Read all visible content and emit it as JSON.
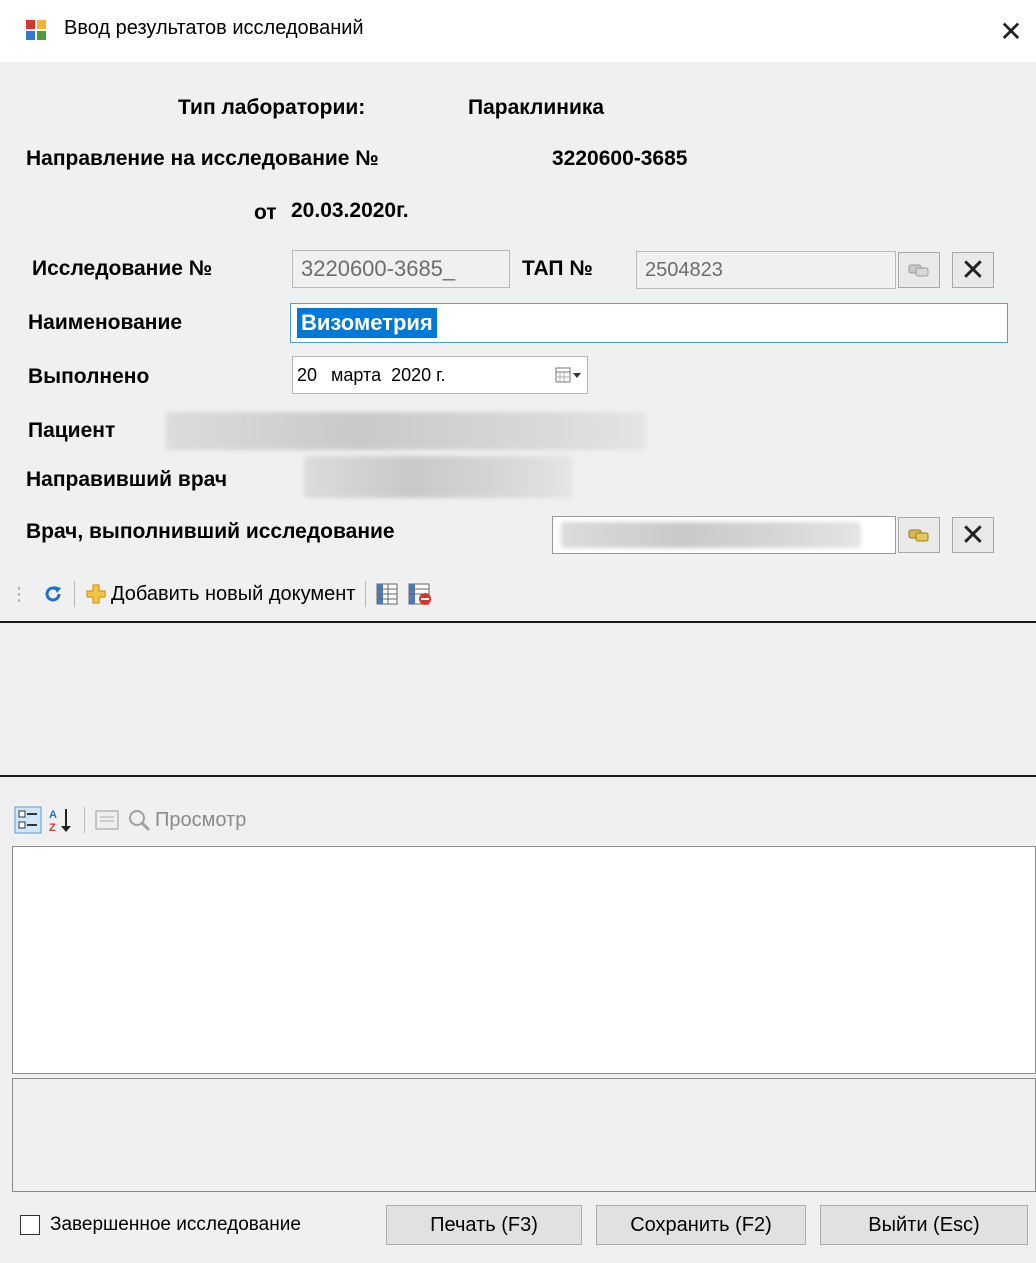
{
  "window": {
    "title": "Ввод результатов исследований",
    "close_glyph": "✕"
  },
  "header": {
    "lab_type_label": "Тип лаборатории:",
    "lab_type_value": "Параклиника",
    "referral_label": "Направление на исследование №",
    "referral_value": "3220600-3685",
    "date_prefix": "от",
    "date_value": "20.03.2020г."
  },
  "form": {
    "study_no_label": "Исследование №",
    "study_no_value": "3220600-3685_",
    "tap_label": "ТАП №",
    "tap_value": "2504823",
    "name_label": "Наименование",
    "name_value": "Визометрия",
    "done_label": "Выполнено",
    "done_day": "20",
    "done_month": "марта",
    "done_year": "2020 г.",
    "patient_label": "Пациент",
    "referring_doctor_label": "Направивший врач",
    "performing_doctor_label": "Врач, выполнивший исследование"
  },
  "toolbar1": {
    "add_document_label": "Добавить новый документ"
  },
  "toolbar2": {
    "view_label": "Просмотр"
  },
  "footer": {
    "completed_label": "Завершенное исследование",
    "print_label": "Печать (F3)",
    "save_label": "Сохранить (F2)",
    "exit_label": "Выйти (Esc)"
  },
  "colors": {
    "selection": "#0078d7",
    "focus_border": "#4aa0dc"
  }
}
